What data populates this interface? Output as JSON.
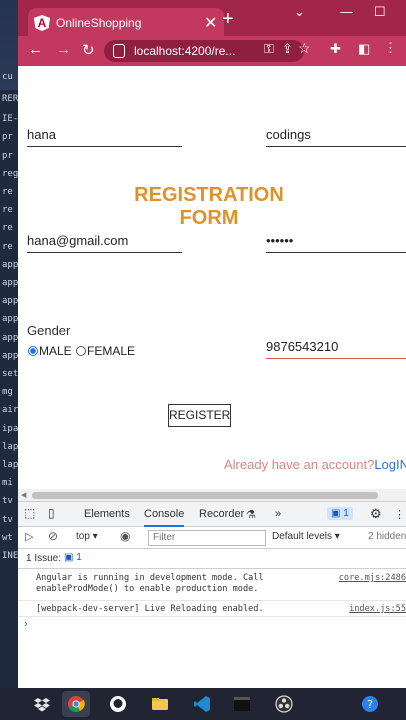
{
  "background_strip": {
    "rows": [
      "cu",
      "RER",
      "IE-S",
      "pr",
      "pr",
      "regi",
      "re",
      "re",
      "re",
      "re",
      "app",
      "app",
      "app",
      "app",
      "app",
      "app",
      "set",
      "mg",
      "air",
      "ipa",
      "lap",
      "lap",
      "mi",
      "tv",
      "tv",
      "wt",
      "INE"
    ]
  },
  "browser": {
    "tab_title": "OnlineShopping",
    "tab_favicon": "A",
    "tab_close": "✕",
    "new_tab": "+",
    "url": "localhost:4200/re...",
    "colors": {
      "tabbar": "#a2264a",
      "toolbar": "#c3385f"
    }
  },
  "form": {
    "first_name": "hana",
    "last_name": "codings",
    "title_line1": "REGISTRATION",
    "title_line2": "FORM",
    "email": "hana@gmail.com",
    "password_mask": "••••••",
    "gender_label": "Gender",
    "gender_options": [
      {
        "label": "MALE",
        "selected": true
      },
      {
        "label": "FEMALE",
        "selected": false
      }
    ],
    "phone": "9876543210",
    "register_label": "REGISTER",
    "already_text": "Already have an account?",
    "login_link": "LogIN",
    "accent_color": "#e0922a"
  },
  "devtools": {
    "tabs": [
      "Elements",
      "Console",
      "Recorder",
      "»"
    ],
    "active_tab": "Console",
    "message_badge": "1",
    "context": "top",
    "filter_placeholder": "Filter",
    "levels": "Default levels",
    "hidden": "2 hidden",
    "issues_label": "1 Issue:",
    "issues_count": "1",
    "logs": [
      {
        "message": "Angular is running in development mode. Call enableProdMode() to enable production mode.",
        "source": "core.mjs:2486"
      },
      {
        "message": "[webpack-dev-server] Live Reloading enabled.",
        "source": "index.js:55"
      }
    ],
    "prompt": "›"
  },
  "taskbar": {
    "apps": [
      "dropbox-icon",
      "chrome-icon",
      "github-icon",
      "file-explorer-icon",
      "code-icon",
      "terminal-icon",
      "obs-icon",
      "help-icon"
    ]
  }
}
